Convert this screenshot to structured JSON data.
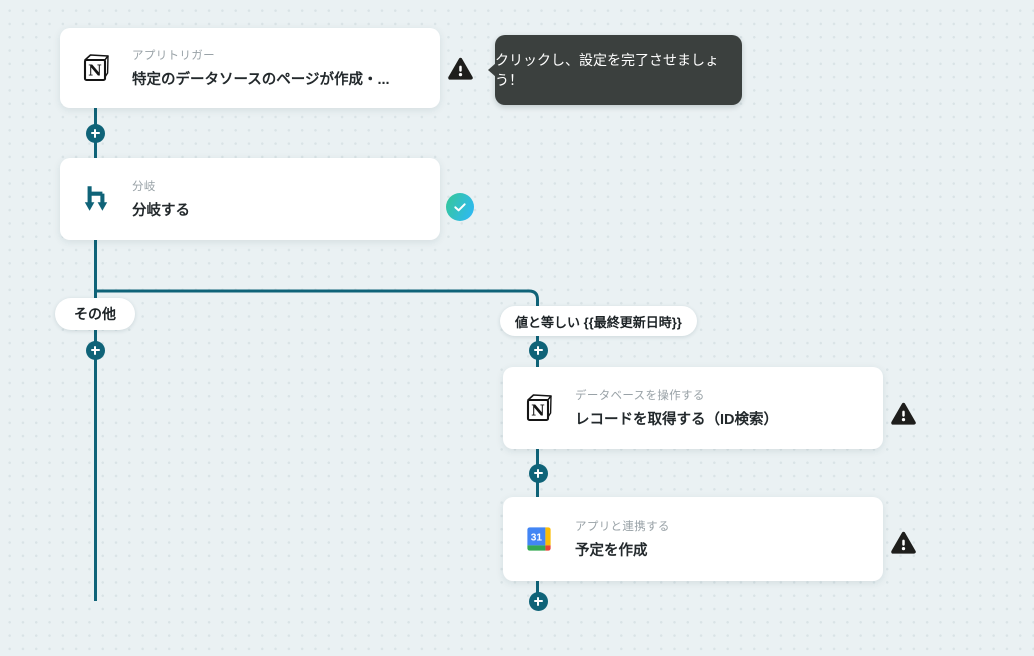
{
  "app": {
    "canvas_bg": "#eaf1f3",
    "grid_dot_color": "#d9e3e6",
    "accent_teal": "#0f6378",
    "warning_color": "#1e1e1c",
    "tooltip_bg": "#3b403e",
    "check_gradient_start": "#35c69f",
    "check_gradient_end": "#2fb9f2"
  },
  "tooltip": {
    "text": "クリックし、設定を完了させましょう！"
  },
  "flow": {
    "trigger": {
      "category": "アプリトリガー",
      "title": "特定のデータソースのページが作成・...",
      "app": "Notion",
      "status": "warning"
    },
    "branch": {
      "category": "分岐",
      "title": "分岐する",
      "status": "complete"
    },
    "branch_left_label": "その他",
    "branch_right_label": "値と等しい {{最終更新日時}}",
    "get_record": {
      "category": "データベースを操作する",
      "title": "レコードを取得する（ID検索）",
      "app": "Notion",
      "status": "warning"
    },
    "create_event": {
      "category": "アプリと連携する",
      "title": "予定を作成",
      "app": "Google Calendar",
      "status": "warning"
    }
  },
  "icons": {
    "notion_letter": "N",
    "calendar_day": "31",
    "warning": "triangle-exclamation",
    "check": "checkmark",
    "plus": "plus",
    "branch": "fork-down-arrows"
  }
}
